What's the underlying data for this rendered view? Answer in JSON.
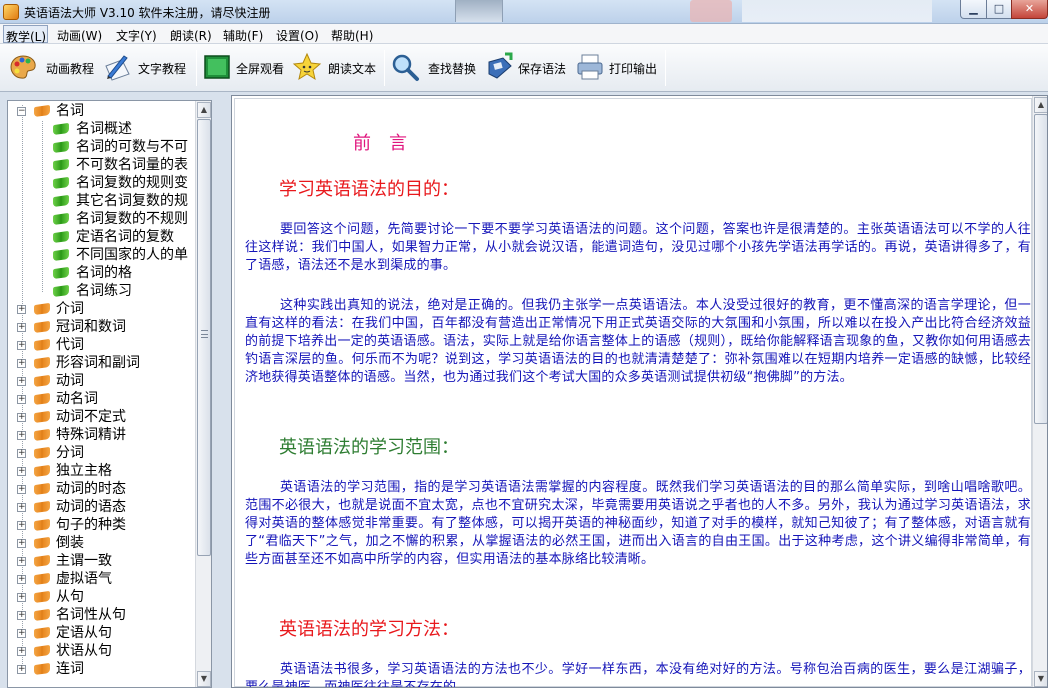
{
  "window": {
    "title": "英语语法大师 V3.10 软件未注册，请尽快注册",
    "controls": {
      "minimize": "▁",
      "maximize": "□",
      "close": "✕"
    }
  },
  "menu": [
    "教学(L)",
    "动画(W)",
    "文字(Y)",
    "朗读(R)",
    "辅助(F)",
    "设置(O)",
    "帮助(H)"
  ],
  "toolbar": [
    {
      "label": "动画教程",
      "icon": "palette-icon"
    },
    {
      "label": "文字教程",
      "icon": "pen-paper-icon"
    },
    {
      "label": "全屏观看",
      "icon": "fullscreen-icon"
    },
    {
      "label": "朗读文本",
      "icon": "star-face-icon"
    },
    {
      "label": "查找替换",
      "icon": "magnifier-icon"
    },
    {
      "label": "保存语法",
      "icon": "save-disk-icon"
    },
    {
      "label": "打印输出",
      "icon": "printer-icon"
    }
  ],
  "tree": {
    "root": {
      "label": "名词",
      "expanded": true,
      "children": [
        "名词概述",
        "名词的可数与不可",
        "不可数名词量的表",
        "名词复数的规则变",
        "其它名词复数的规",
        "名词复数的不规则",
        "定语名词的复数",
        "不同国家的人的单",
        "名词的格",
        "名词练习"
      ]
    },
    "collapsed": [
      "介词",
      "冠词和数词",
      "代词",
      "形容词和副词",
      "动词",
      "动名词",
      "动词不定式",
      "特殊词精讲",
      "分词",
      "独立主格",
      "动词的时态",
      "动词的语态",
      "句子的种类",
      "倒装",
      "主谓一致",
      "虚拟语气",
      "从句",
      "名词性从句",
      "定语从句",
      "状语从句",
      "连词"
    ]
  },
  "document": {
    "title": "前　言",
    "heading1": "学习英语语法的目的：",
    "para1": "要回答这个问题，先简要讨论一下要不要学习英语语法的问题。这个问题，答案也许是很清楚的。主张英语语法可以不学的人往往这样说：我们中国人，如果智力正常，从小就会说汉语，能遣词造句，没见过哪个小孩先学语法再学话的。再说，英语讲得多了，有了语感，语法还不是水到渠成的事。",
    "para2": "这种实践出真知的说法，绝对是正确的。但我仍主张学一点英语语法。本人没受过很好的教育，更不懂高深的语言学理论，但一直有这样的看法：在我们中国，百年都没有营造出正常情况下用正式英语交际的大氛围和小氛围，所以难以在投入产出比符合经济效益的前提下培养出一定的英语语感。语法，实际上就是给你语言整体上的语感（规则），既给你能解释语言现象的鱼，又教你如何用语感去钓语言深层的鱼。何乐而不为呢？说到这，学习英语语法的目的也就清清楚楚了：弥补氛围难以在短期内培养一定语感的缺憾，比较经济地获得英语整体的语感。当然，也为通过我们这个考试大国的众多英语测试提供初级“抱佛脚”的方法。",
    "heading2": "英语语法的学习范围：",
    "para3": "英语语法的学习范围，指的是学习英语语法需掌握的内容程度。既然我们学习英语语法的目的那么简单实际，到啥山唱啥歌吧。范围不必很大，也就是说面不宜太宽，点也不宜研究太深，毕竟需要用英语说之乎者也的人不多。另外，我认为通过学习英语语法，求得对英语的整体感觉非常重要。有了整体感，可以揭开英语的神秘面纱，知道了对手的模样，就知己知彼了；有了整体感，对语言就有了“君临天下”之气，加之不懈的积累，从掌握语法的必然王国，进而出入语言的自由王国。出于这种考虑，这个讲义编得非常简单，有些方面甚至还不如高中所学的内容，但实用语法的基本脉络比较清晰。",
    "heading3": "英语语法的学习方法：",
    "para4": "英语语法书很多，学习英语语法的方法也不少。学好一样东西，本没有绝对好的方法。号称包治百病的医生，要么是江湖骗子，要么是神医，而神医往往是不存在的。"
  },
  "colors": {
    "title": "#e0157e",
    "heading_red": "#e8181c",
    "heading_green": "#2e7d32",
    "body": "#1414b8"
  }
}
